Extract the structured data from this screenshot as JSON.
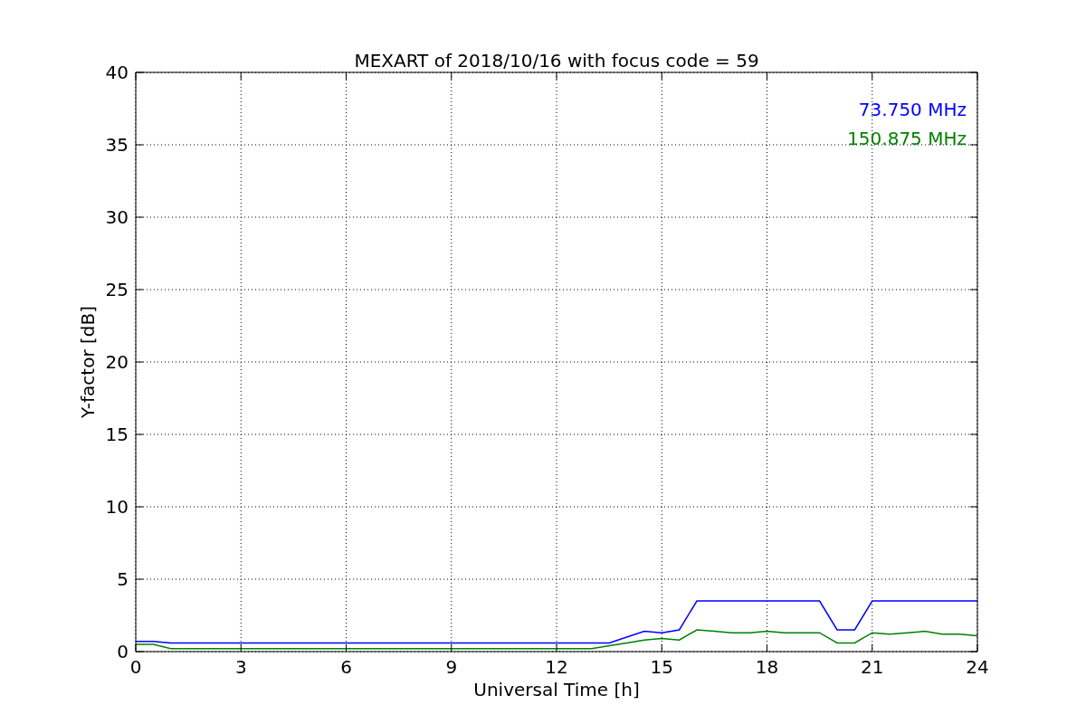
{
  "chart_data": {
    "type": "line",
    "title": "MEXART of 2018/10/16 with focus code = 59",
    "xlabel": "Universal Time [h]",
    "ylabel": "Y-factor [dB]",
    "x": [
      0,
      0.5,
      1,
      1.5,
      2,
      2.5,
      3,
      3.5,
      4,
      4.5,
      5,
      5.5,
      6,
      6.5,
      7,
      7.5,
      8,
      8.5,
      9,
      9.5,
      10,
      10.5,
      11,
      11.5,
      12,
      12.5,
      13,
      13.5,
      14,
      14.5,
      15,
      15.5,
      16,
      16.5,
      17,
      17.5,
      18,
      18.5,
      19,
      19.5,
      20,
      20.5,
      21,
      21.5,
      22,
      22.5,
      23,
      23.5,
      24
    ],
    "series": [
      {
        "name": "73.750 MHz",
        "color": "#0000ff",
        "values": [
          0.7,
          0.7,
          0.6,
          0.6,
          0.6,
          0.6,
          0.6,
          0.6,
          0.6,
          0.6,
          0.6,
          0.6,
          0.6,
          0.6,
          0.6,
          0.6,
          0.6,
          0.6,
          0.6,
          0.6,
          0.6,
          0.6,
          0.6,
          0.6,
          0.6,
          0.6,
          0.6,
          0.6,
          1.0,
          1.4,
          1.3,
          1.5,
          3.5,
          3.5,
          3.5,
          3.5,
          3.5,
          3.5,
          3.5,
          3.5,
          1.5,
          1.5,
          3.5,
          3.5,
          3.5,
          3.5,
          3.5,
          3.5,
          3.5
        ]
      },
      {
        "name": "150.875 MHz",
        "color": "#008000",
        "values": [
          0.5,
          0.5,
          0.2,
          0.2,
          0.2,
          0.2,
          0.2,
          0.2,
          0.2,
          0.2,
          0.2,
          0.2,
          0.2,
          0.2,
          0.2,
          0.2,
          0.2,
          0.2,
          0.2,
          0.2,
          0.2,
          0.2,
          0.2,
          0.2,
          0.2,
          0.2,
          0.2,
          0.4,
          0.6,
          0.8,
          0.9,
          0.8,
          1.5,
          1.4,
          1.3,
          1.3,
          1.4,
          1.3,
          1.3,
          1.3,
          0.6,
          0.6,
          1.3,
          1.2,
          1.3,
          1.4,
          1.2,
          1.2,
          1.1
        ]
      }
    ],
    "grid": true,
    "xlim": [
      0,
      24
    ],
    "ylim": [
      0,
      40
    ],
    "xticks": [
      0,
      3,
      6,
      9,
      12,
      15,
      18,
      21,
      24
    ],
    "yticks": [
      0,
      5,
      10,
      15,
      20,
      25,
      30,
      35,
      40
    ]
  }
}
